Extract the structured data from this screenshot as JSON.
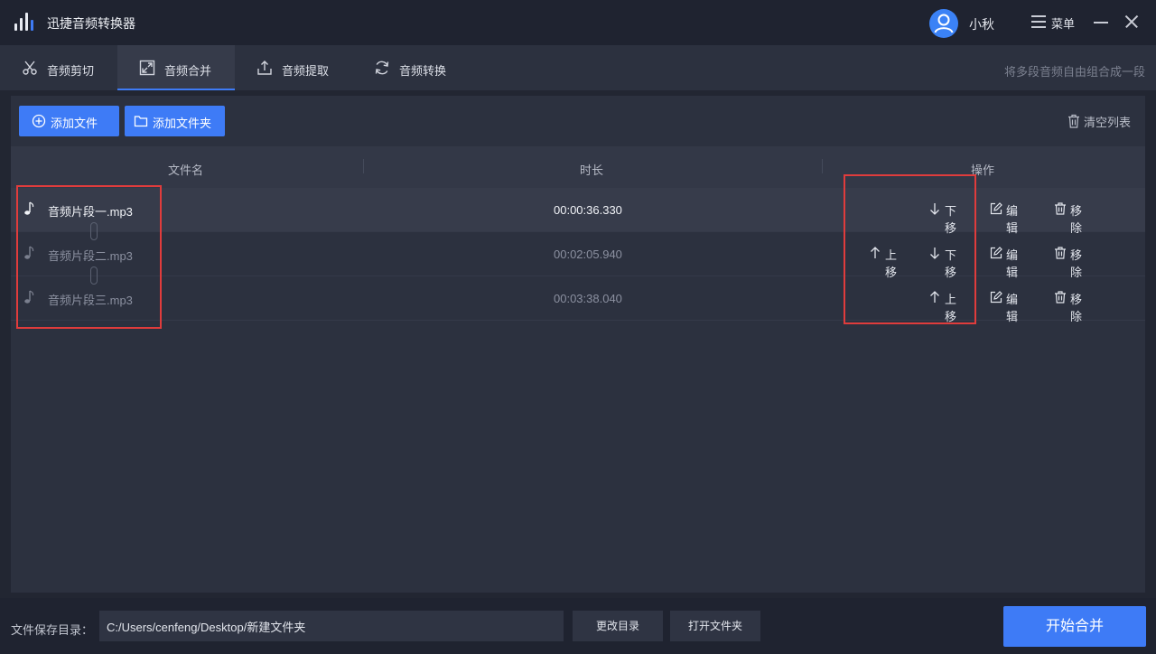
{
  "app": {
    "title": "迅捷音频转换器"
  },
  "user": {
    "name": "小秋"
  },
  "window": {
    "menu_label": "菜单"
  },
  "tabs": [
    {
      "label": "音频剪切",
      "icon": "scissors-icon"
    },
    {
      "label": "音频合并",
      "icon": "merge-icon",
      "active": true
    },
    {
      "label": "音频提取",
      "icon": "extract-icon"
    },
    {
      "label": "音频转换",
      "icon": "convert-icon"
    }
  ],
  "hint": "将多段音频自由组合成一段",
  "toolbar": {
    "add_file": "添加文件",
    "add_folder": "添加文件夹",
    "clear_list": "清空列表"
  },
  "table": {
    "headers": {
      "filename": "文件名",
      "duration": "时长",
      "actions": "操作"
    },
    "rows": [
      {
        "filename": "音频片段一.mp3",
        "duration": "00:00:36.330",
        "actions": [
          "下移",
          "编辑",
          "移除"
        ]
      },
      {
        "filename": "音频片段二.mp3",
        "duration": "00:02:05.940",
        "actions": [
          "上移",
          "下移",
          "编辑",
          "移除"
        ]
      },
      {
        "filename": "音频片段三.mp3",
        "duration": "00:03:38.040",
        "actions": [
          "上移",
          "编辑",
          "移除"
        ]
      }
    ]
  },
  "footer": {
    "save_label": "文件保存目录：",
    "save_path": "C:/Users/cenfeng/Desktop/新建文件夹",
    "change_dir": "更改目录",
    "open_folder": "打开文件夹",
    "start": "开始合并"
  },
  "colors": {
    "accent": "#3e7bf6",
    "highlight": "#e03c3c",
    "background": "#222632"
  }
}
